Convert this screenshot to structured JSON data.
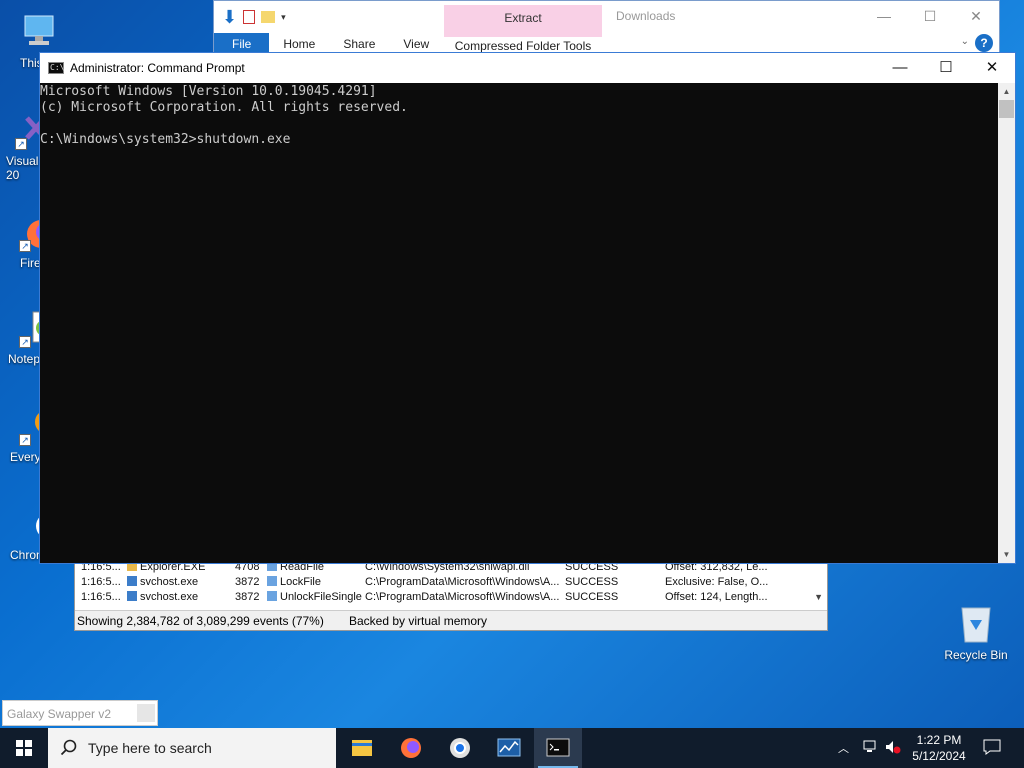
{
  "desktop": {
    "icons": [
      {
        "label": "This"
      },
      {
        "label": "Visual\n20"
      },
      {
        "label": "Fire"
      },
      {
        "label": "Notep"
      },
      {
        "label": "Every"
      },
      {
        "label": "Chrom"
      }
    ],
    "recycle_bin": "Recycle Bin"
  },
  "explorer": {
    "title": "Downloads",
    "tabs": [
      "File",
      "Home",
      "Share",
      "View"
    ],
    "contextual_group": "Extract",
    "contextual_tab": "Compressed Folder Tools"
  },
  "cmd": {
    "title": "Administrator: Command Prompt",
    "lines": [
      "Microsoft Windows [Version 10.0.19045.4291]",
      "(c) Microsoft Corporation. All rights reserved.",
      "",
      "C:\\Windows\\system32>shutdown.exe"
    ]
  },
  "procmon": {
    "rows": [
      {
        "time": "1:16:5...",
        "process": "Explorer.EXE",
        "pid": "4708",
        "op": "ReadFile",
        "path": "C:\\Windows\\System32\\shlwapi.dll",
        "result": "SUCCESS",
        "detail": "Offset: 312,832, Le..."
      },
      {
        "time": "1:16:5...",
        "process": "svchost.exe",
        "pid": "3872",
        "op": "LockFile",
        "path": "C:\\ProgramData\\Microsoft\\Windows\\A...",
        "result": "SUCCESS",
        "detail": "Exclusive: False, O..."
      },
      {
        "time": "1:16:5...",
        "process": "svchost.exe",
        "pid": "3872",
        "op": "UnlockFileSingle",
        "path": "C:\\ProgramData\\Microsoft\\Windows\\A...",
        "result": "SUCCESS",
        "detail": "Offset: 124, Length..."
      }
    ],
    "status_events": "Showing 2,384,782 of 3,089,299 events (77%)",
    "status_memory": "Backed by virtual memory"
  },
  "galaxy": {
    "title": "Galaxy Swapper v2"
  },
  "taskbar": {
    "search_placeholder": "Type here to search",
    "apps": [
      "file-explorer-icon",
      "firefox-icon",
      "chrome-icon",
      "process-monitor-icon",
      "command-prompt-icon"
    ],
    "time": "1:22 PM",
    "date": "5/12/2024"
  }
}
